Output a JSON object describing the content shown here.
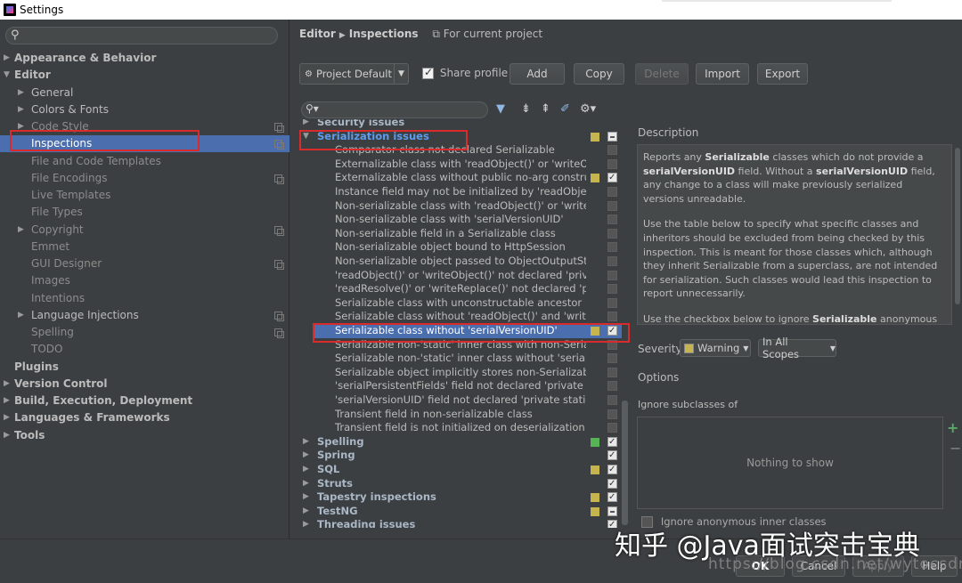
{
  "window": {
    "title": "Settings"
  },
  "left": {
    "search_icon": "search-icon",
    "items": [
      {
        "label": "Appearance & Behavior",
        "bold": true,
        "arrow": "▶",
        "level": 0
      },
      {
        "label": "Editor",
        "bold": true,
        "arrow": "▼",
        "level": 0
      },
      {
        "label": "General",
        "arrow": "▶",
        "level": 1
      },
      {
        "label": "Colors & Fonts",
        "arrow": "▶",
        "level": 1
      },
      {
        "label": "Code Style",
        "arrow": "▶",
        "level": 1,
        "copy": true
      },
      {
        "label": "Inspections",
        "level": 1,
        "selected": true,
        "copy": true
      },
      {
        "label": "File and Code Templates",
        "level": 1
      },
      {
        "label": "File Encodings",
        "level": 1,
        "copy": true
      },
      {
        "label": "Live Templates",
        "level": 1
      },
      {
        "label": "File Types",
        "level": 1
      },
      {
        "label": "Copyright",
        "arrow": "▶",
        "level": 1,
        "copy": true
      },
      {
        "label": "Emmet",
        "level": 1
      },
      {
        "label": "GUI Designer",
        "level": 1,
        "copy": true
      },
      {
        "label": "Images",
        "level": 1
      },
      {
        "label": "Intentions",
        "level": 1
      },
      {
        "label": "Language Injections",
        "arrow": "▶",
        "level": 1,
        "copy": true
      },
      {
        "label": "Spelling",
        "level": 1,
        "copy": true
      },
      {
        "label": "TODO",
        "level": 1
      },
      {
        "label": "Plugins",
        "bold": true,
        "level": 0
      },
      {
        "label": "Version Control",
        "bold": true,
        "arrow": "▶",
        "level": 0
      },
      {
        "label": "Build, Execution, Deployment",
        "bold": true,
        "arrow": "▶",
        "level": 0
      },
      {
        "label": "Languages & Frameworks",
        "bold": true,
        "arrow": "▶",
        "level": 0
      },
      {
        "label": "Tools",
        "bold": true,
        "arrow": "▶",
        "level": 0
      }
    ]
  },
  "breadcrumb": {
    "part1": "Editor",
    "part2": "Inspections",
    "project_icon": "project-icon",
    "project": "For current project"
  },
  "toolbar": {
    "profile": "Project Default",
    "share_label": "Share profile",
    "add": "Add",
    "copy": "Copy",
    "delete": "Delete",
    "import": "Import",
    "export": "Export"
  },
  "inspections": [
    {
      "label": "Security issues",
      "type": "group",
      "arrow": "▶",
      "cb": "none"
    },
    {
      "label": "Serialization issues",
      "type": "group",
      "arrow": "▼",
      "sev": "#c6b54f",
      "cb": "part"
    },
    {
      "label": "Comparator class not declared Serializable",
      "cb": "off"
    },
    {
      "label": "Externalizable class with 'readObject()' or 'writeObjec",
      "cb": "off"
    },
    {
      "label": "Externalizable class without public no-arg constructor",
      "sev": "#c6b54f",
      "cb": "on"
    },
    {
      "label": "Instance field may not be initialized by 'readObject()'",
      "cb": "off"
    },
    {
      "label": "Non-serializable class with 'readObject()' or 'writeObj",
      "cb": "off"
    },
    {
      "label": "Non-serializable class with 'serialVersionUID'",
      "cb": "off"
    },
    {
      "label": "Non-serializable field in a Serializable class",
      "cb": "off"
    },
    {
      "label": "Non-serializable object bound to HttpSession",
      "cb": "off"
    },
    {
      "label": "Non-serializable object passed to ObjectOutputStrea",
      "cb": "off"
    },
    {
      "label": "'readObject()' or 'writeObject()' not declared 'private'",
      "cb": "off"
    },
    {
      "label": "'readResolve()' or 'writeReplace()' not declared 'prote",
      "cb": "off"
    },
    {
      "label": "Serializable class with unconstructable ancestor",
      "cb": "off"
    },
    {
      "label": "Serializable class without 'readObject()' and 'writeObj",
      "cb": "off"
    },
    {
      "label": "Serializable class without 'serialVersionUID'",
      "sev": "#c6b54f",
      "cb": "on",
      "selected": true
    },
    {
      "label": "Serializable non-'static' inner class with non-Serializab",
      "cb": "off"
    },
    {
      "label": "Serializable non-'static' inner class without 'serialVers",
      "cb": "off"
    },
    {
      "label": "Serializable object implicitly stores non-Serializable o",
      "cb": "off"
    },
    {
      "label": "'serialPersistentFields' field not declared 'private stati",
      "cb": "off"
    },
    {
      "label": "'serialVersionUID' field not declared 'private static fin",
      "cb": "off"
    },
    {
      "label": "Transient field in non-serializable class",
      "cb": "off"
    },
    {
      "label": "Transient field is not initialized on deserialization",
      "cb": "off"
    },
    {
      "label": "Spelling",
      "type": "group",
      "arrow": "▶",
      "sev": "#56b356",
      "cb": "on"
    },
    {
      "label": "Spring",
      "type": "group",
      "arrow": "▶",
      "cb": "on"
    },
    {
      "label": "SQL",
      "type": "group",
      "arrow": "▶",
      "sev": "#c6b54f",
      "cb": "on"
    },
    {
      "label": "Struts",
      "type": "group",
      "arrow": "▶",
      "cb": "on"
    },
    {
      "label": "Tapestry inspections",
      "type": "group",
      "arrow": "▶",
      "sev": "#c6b54f",
      "cb": "on"
    },
    {
      "label": "TestNG",
      "type": "group",
      "arrow": "▶",
      "sev": "#c6b54f",
      "cb": "part"
    },
    {
      "label": "Threading issues",
      "type": "group",
      "arrow": "▶",
      "cb": "on"
    }
  ],
  "description": {
    "label": "Description",
    "p1_a": "Reports any ",
    "p1_b": "Serializable",
    "p1_c": " classes which do not provide a ",
    "p1_d": "serialVersionUID",
    "p1_e": " field. Without a ",
    "p1_f": "serialVersionUID",
    "p1_g": " field, any change to a class will make previously serialized versions unreadable.",
    "p2": "Use the table below to specify what specific classes and inheritors should be excluded from being checked by this inspection. This is meant for those classes which, although they inherit Serializable from a superclass, are not intended for serialization. Such classes would lead this inspection to report unnecessarily.",
    "p3_a": "Use the checkbox below to ignore ",
    "p3_b": "Serializable",
    "p3_c": " anonymous"
  },
  "severity": {
    "label": "Severity:",
    "value": "Warning",
    "color": "#c6b54f",
    "scope": "In All Scopes"
  },
  "options": {
    "label": "Options",
    "ignore_label": "Ignore subclasses of",
    "empty": "Nothing to show",
    "plus": "+",
    "minus": "−",
    "anon": "Ignore anonymous inner classes"
  },
  "footer": {
    "ok": "OK",
    "cancel": "Cancel",
    "apply": "Apply",
    "help": "Help"
  },
  "watermark": {
    "main": "知乎 @Java面试突击宝典",
    "url": "https://blog.csdn.net/wytocsdn"
  }
}
